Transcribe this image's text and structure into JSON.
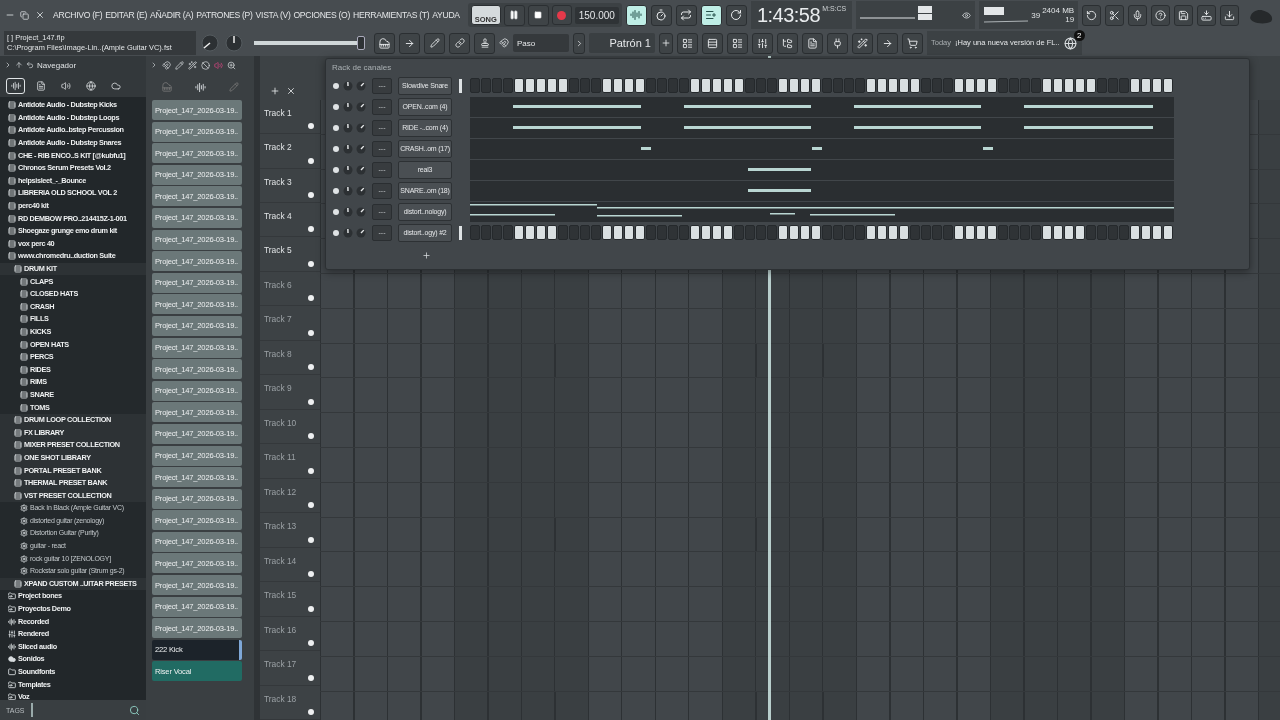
{
  "menu": [
    "ARCHIVO (F)",
    "EDITAR (E)",
    "AÑADIR (A)",
    "PATRONES (P)",
    "VISTA (V)",
    "OPCIONES (O)",
    "HERRAMIENTAS (T)",
    "AYUDA"
  ],
  "transport": {
    "mode": "SONG",
    "playing": true,
    "tempo": "150.000"
  },
  "mode_buttons": [
    {
      "selected": true
    },
    {
      "selected": false
    },
    {
      "selected": false
    },
    {
      "selected": true
    },
    {
      "selected": false
    }
  ],
  "clock": {
    "time": "1:43:58",
    "format": "M:S:CS"
  },
  "cpu": {
    "polyphony": "39",
    "memory": "2404 MB",
    "value": "19"
  },
  "hint": {
    "line1": "[   ] Project_147.flp",
    "line2": "C:\\Program Files\\Image-Lin..(Ample Guitar VC).fst"
  },
  "master": {
    "level": 0.97
  },
  "snap": "Paso",
  "pattern": "Patrón 1",
  "news": {
    "label": "Today",
    "message": "¡Hay una nueva versión de FL..",
    "badge": "2"
  },
  "browser": {
    "title": "Navegador",
    "tabs": [
      {
        "selected": true
      },
      {
        "selected": false
      },
      {
        "selected": false
      },
      {
        "selected": false
      },
      {
        "selected": false
      }
    ],
    "tags_label": "TAGS",
    "tree": [
      {
        "name": "Antidote Audio - Dubstep Kicks",
        "kind": "pack"
      },
      {
        "name": "Antidote Audio - Dubstep Loops",
        "kind": "pack"
      },
      {
        "name": "Antidote Audio..bstep Percussion",
        "kind": "pack"
      },
      {
        "name": "Antidote Audio - Dubstep Snares",
        "kind": "pack"
      },
      {
        "name": "CHE - RIB ENCO..S KIT [@kubfu1]",
        "kind": "pack"
      },
      {
        "name": "Chronos Serum Presets Vol.2",
        "kind": "pack"
      },
      {
        "name": "helpsisleet_-_Bounce",
        "kind": "pack"
      },
      {
        "name": "LIBRERIA OLD SCHOOL  VOL 2",
        "kind": "pack"
      },
      {
        "name": "perc40 kit",
        "kind": "pack"
      },
      {
        "name": "RD DEMBOW PRO..214415Z-1-001",
        "kind": "pack"
      },
      {
        "name": "Shoegaze grunge emo drum kit",
        "kind": "pack"
      },
      {
        "name": "vox perc 40",
        "kind": "pack"
      },
      {
        "name": "www.chromedru..duction Suite",
        "kind": "pack",
        "children": [
          {
            "name": "DRUM KIT",
            "kind": "pack",
            "children": [
              {
                "name": "CLAPS",
                "kind": "pack"
              },
              {
                "name": "CLOSED HATS",
                "kind": "pack"
              },
              {
                "name": "CRASH",
                "kind": "pack"
              },
              {
                "name": "FILLS",
                "kind": "pack"
              },
              {
                "name": "KICKS",
                "kind": "pack"
              },
              {
                "name": "OPEN HATS",
                "kind": "pack"
              },
              {
                "name": "PERCS",
                "kind": "pack"
              },
              {
                "name": "RIDES",
                "kind": "pack"
              },
              {
                "name": "RIMS",
                "kind": "pack"
              },
              {
                "name": "SNARE",
                "kind": "pack"
              },
              {
                "name": "TOMS",
                "kind": "pack"
              }
            ]
          },
          {
            "name": "DRUM LOOP COLLECTION",
            "kind": "pack"
          },
          {
            "name": "FX LIBRARY",
            "kind": "pack"
          },
          {
            "name": "MIXER PRESET COLLECTION",
            "kind": "pack"
          },
          {
            "name": "ONE SHOT LIBRARY",
            "kind": "pack"
          },
          {
            "name": "PORTAL PRESET BANK",
            "kind": "pack"
          },
          {
            "name": "THERMAL PRESET BANK",
            "kind": "pack"
          },
          {
            "name": "VST PRESET COLLECTION",
            "kind": "pack",
            "children": [
              {
                "name": "Back In Black (Ample Guitar VC)",
                "kind": "preset"
              },
              {
                "name": "distorted guitar (zenology)",
                "kind": "preset"
              },
              {
                "name": "Distortion Guitar (Purity)",
                "kind": "preset"
              },
              {
                "name": "guitar - react",
                "kind": "preset"
              },
              {
                "name": "rock guitar 10 [ZENOLOGY]",
                "kind": "preset"
              },
              {
                "name": "Rockstar solo guitar (Strum gs-2)",
                "kind": "preset"
              }
            ]
          },
          {
            "name": "XPAND CUSTOM ..UITAR PRESETS",
            "kind": "pack"
          }
        ]
      },
      {
        "name": "Project bones",
        "kind": "folder"
      },
      {
        "name": "Proyectos Demo",
        "kind": "folder"
      },
      {
        "name": "Recorded",
        "kind": "audio"
      },
      {
        "name": "Rendered",
        "kind": "rendered"
      },
      {
        "name": "Sliced audio",
        "kind": "audio"
      },
      {
        "name": "Sonidos",
        "kind": "cloud"
      },
      {
        "name": "Soundfonts",
        "kind": "plain"
      },
      {
        "name": "Templates",
        "kind": "folder"
      },
      {
        "name": "Voz",
        "kind": "folder"
      }
    ]
  },
  "pattern_list": {
    "clips": [
      {
        "name": "Project_147_2026-03-19..",
        "color": "#6b7879",
        "selected": false
      },
      {
        "name": "Project_147_2026-03-19..",
        "color": "#6b7879",
        "selected": false
      },
      {
        "name": "Project_147_2026-03-19..",
        "color": "#6b7879",
        "selected": false
      },
      {
        "name": "Project_147_2026-03-19..",
        "color": "#6b7879",
        "selected": false
      },
      {
        "name": "Project_147_2026-03-19..",
        "color": "#6b7879",
        "selected": false
      },
      {
        "name": "Project_147_2026-03-19..",
        "color": "#6b7879",
        "selected": false
      },
      {
        "name": "Project_147_2026-03-19..",
        "color": "#6b7879",
        "selected": false
      },
      {
        "name": "Project_147_2026-03-19..",
        "color": "#6b7879",
        "selected": false
      },
      {
        "name": "Project_147_2026-03-19..",
        "color": "#6b7879",
        "selected": false
      },
      {
        "name": "Project_147_2026-03-19..",
        "color": "#6b7879",
        "selected": false
      },
      {
        "name": "Project_147_2026-03-19..",
        "color": "#6b7879",
        "selected": false
      },
      {
        "name": "Project_147_2026-03-19..",
        "color": "#6b7879",
        "selected": false
      },
      {
        "name": "Project_147_2026-03-19..",
        "color": "#6b7879",
        "selected": false
      },
      {
        "name": "Project_147_2026-03-19..",
        "color": "#6b7879",
        "selected": false
      },
      {
        "name": "Project_147_2026-03-19..",
        "color": "#6b7879",
        "selected": false
      },
      {
        "name": "Project_147_2026-03-19..",
        "color": "#6b7879",
        "selected": false
      },
      {
        "name": "Project_147_2026-03-19..",
        "color": "#6b7879",
        "selected": false
      },
      {
        "name": "Project_147_2026-03-19..",
        "color": "#6b7879",
        "selected": false
      },
      {
        "name": "Project_147_2026-03-19..",
        "color": "#6b7879",
        "selected": false
      },
      {
        "name": "Project_147_2026-03-19..",
        "color": "#6b7879",
        "selected": false
      },
      {
        "name": "Project_147_2026-03-19..",
        "color": "#6b7879",
        "selected": false
      },
      {
        "name": "Project_147_2026-03-19..",
        "color": "#6b7879",
        "selected": false
      },
      {
        "name": "Project_147_2026-03-19..",
        "color": "#6b7879",
        "selected": false
      },
      {
        "name": "Project_147_2026-03-19..",
        "color": "#6b7879",
        "selected": false
      },
      {
        "name": "Project_147_2026-03-19..",
        "color": "#6b7879",
        "selected": false
      },
      {
        "name": "222 Kick",
        "color": "#1c232a",
        "selected": true
      },
      {
        "name": "Riser Vocal",
        "color": "#216b63",
        "selected": false
      }
    ]
  },
  "channel_rack": {
    "title": "Rack de canales",
    "channels": [
      {
        "name": "Slowdive Snare",
        "mixer": "---",
        "kind": "steps",
        "steps": [
          false,
          false,
          false,
          false,
          true,
          true,
          true,
          true,
          true,
          false,
          false,
          false,
          true,
          true,
          true,
          true,
          false,
          false,
          false,
          false,
          true,
          true,
          true,
          true,
          true,
          false,
          false,
          false,
          true,
          true,
          true,
          true,
          false,
          false,
          false,
          false,
          true,
          true,
          true,
          true,
          true,
          false,
          false,
          false,
          true,
          true,
          true,
          true,
          false,
          false,
          false,
          false,
          true,
          true,
          true,
          true,
          true,
          false,
          false,
          false,
          true,
          true,
          true,
          true
        ]
      },
      {
        "name": "OPEN..com (4)",
        "mixer": "---",
        "kind": "roll"
      },
      {
        "name": "RIDE -..com (4)",
        "mixer": "---",
        "kind": "roll"
      },
      {
        "name": "CRASH..om (17)",
        "mixer": "---",
        "kind": "roll"
      },
      {
        "name": "real3",
        "mixer": "---",
        "kind": "roll"
      },
      {
        "name": "SNARE..om (18)",
        "mixer": "---",
        "kind": "roll"
      },
      {
        "name": "distort..nology)",
        "mixer": "---",
        "kind": "roll"
      },
      {
        "name": "distort..ogy) #2",
        "mixer": "---",
        "kind": "steps",
        "steps": [
          false,
          false,
          false,
          false,
          true,
          true,
          true,
          true,
          false,
          false,
          false,
          false,
          true,
          true,
          true,
          true,
          false,
          false,
          false,
          false,
          true,
          true,
          true,
          true,
          false,
          false,
          false,
          false,
          true,
          true,
          true,
          true,
          false,
          false,
          false,
          false,
          true,
          true,
          true,
          true,
          false,
          false,
          false,
          false,
          true,
          true,
          true,
          true,
          false,
          false,
          false,
          false,
          true,
          true,
          true,
          true,
          false,
          false,
          false,
          false,
          true,
          true,
          true,
          true
        ]
      }
    ]
  },
  "playlist": {
    "tracks": [
      {
        "name": "Track 1",
        "has_content": true
      },
      {
        "name": "Track 2",
        "has_content": true
      },
      {
        "name": "Track 3",
        "has_content": true
      },
      {
        "name": "Track 4",
        "has_content": true
      },
      {
        "name": "Track 5",
        "has_content": true
      },
      {
        "name": "Track 6",
        "has_content": false
      },
      {
        "name": "Track 7",
        "has_content": false
      },
      {
        "name": "Track 8",
        "has_content": false
      },
      {
        "name": "Track 9",
        "has_content": false
      },
      {
        "name": "Track 10",
        "has_content": false
      },
      {
        "name": "Track 11",
        "has_content": false
      },
      {
        "name": "Track 12",
        "has_content": false
      },
      {
        "name": "Track 13",
        "has_content": false
      },
      {
        "name": "Track 14",
        "has_content": false
      },
      {
        "name": "Track 15",
        "has_content": false
      },
      {
        "name": "Track 16",
        "has_content": false
      },
      {
        "name": "Track 17",
        "has_content": false
      },
      {
        "name": "Track 18",
        "has_content": false
      }
    ]
  }
}
